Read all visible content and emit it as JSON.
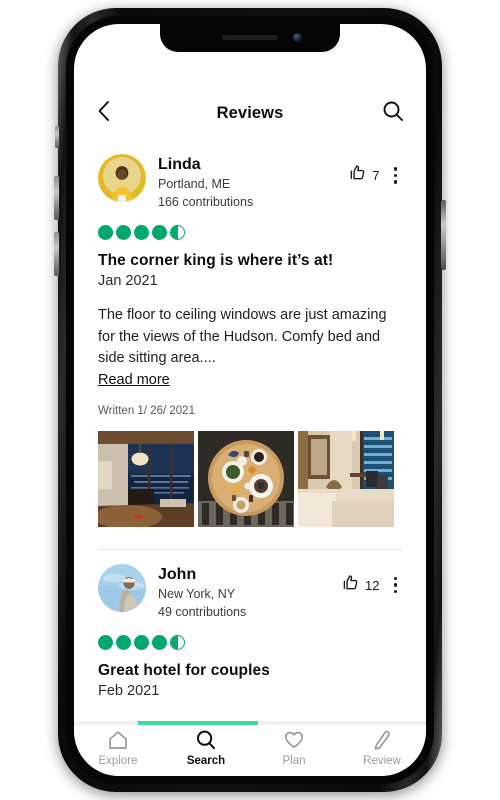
{
  "device": {
    "notch_icons": [
      "speaker-grille",
      "front-camera"
    ],
    "buttons": [
      "mute-switch",
      "volume-up",
      "volume-down",
      "power-button"
    ]
  },
  "header": {
    "back_icon": "chevron-left-icon",
    "title": "Reviews",
    "search_icon": "search-icon"
  },
  "colors": {
    "rating_green": "#00a870",
    "scroll_green": "#3ddc97",
    "text_primary": "#0d0d0d",
    "text_muted": "#9b9b9b"
  },
  "reviews": [
    {
      "author": "Linda",
      "location": "Portland, ME",
      "contributions": "166 contributions",
      "avatar_name": "avatar-linda",
      "like_icon": "thumbs-up-icon",
      "like_count": "7",
      "menu_icon": "overflow-menu-icon",
      "rating": 4.5,
      "rating_max": 5,
      "title": "The corner king is where it’s at!",
      "date": "Jan 2021",
      "body": "The floor to ceiling windows are just amazing for the views of the Hudson. Comfy bed and side sitting area....",
      "read_more_label": "Read more",
      "written_on": "Written 1/ 26/ 2021",
      "photos": [
        {
          "name": "photo-hotel-room-window-view",
          "alt": "Hotel room with floor to ceiling windows at dusk"
        },
        {
          "name": "photo-breakfast-tray",
          "alt": "Overhead breakfast spread on round wooden tray"
        },
        {
          "name": "photo-room-seating-area",
          "alt": "Room with side sitting area and city view"
        }
      ]
    },
    {
      "author": "John",
      "location": "New York, NY",
      "contributions": "49 contributions",
      "avatar_name": "avatar-john",
      "like_icon": "thumbs-up-icon",
      "like_count": "12",
      "menu_icon": "overflow-menu-icon",
      "rating": 4.5,
      "rating_max": 5,
      "title": "Great hotel for couples",
      "date": "Feb 2021",
      "body": "",
      "read_more_label": "",
      "written_on": "",
      "photos": []
    }
  ],
  "scrollbar": {
    "position_pct": 18,
    "thumb_width_pct": 34
  },
  "bottom_nav": {
    "items": [
      {
        "label": "Explore",
        "icon": "home-icon",
        "active": false
      },
      {
        "label": "Search",
        "icon": "search-icon",
        "active": true
      },
      {
        "label": "Plan",
        "icon": "heart-icon",
        "active": false
      },
      {
        "label": "Review",
        "icon": "pencil-icon",
        "active": false
      }
    ]
  }
}
